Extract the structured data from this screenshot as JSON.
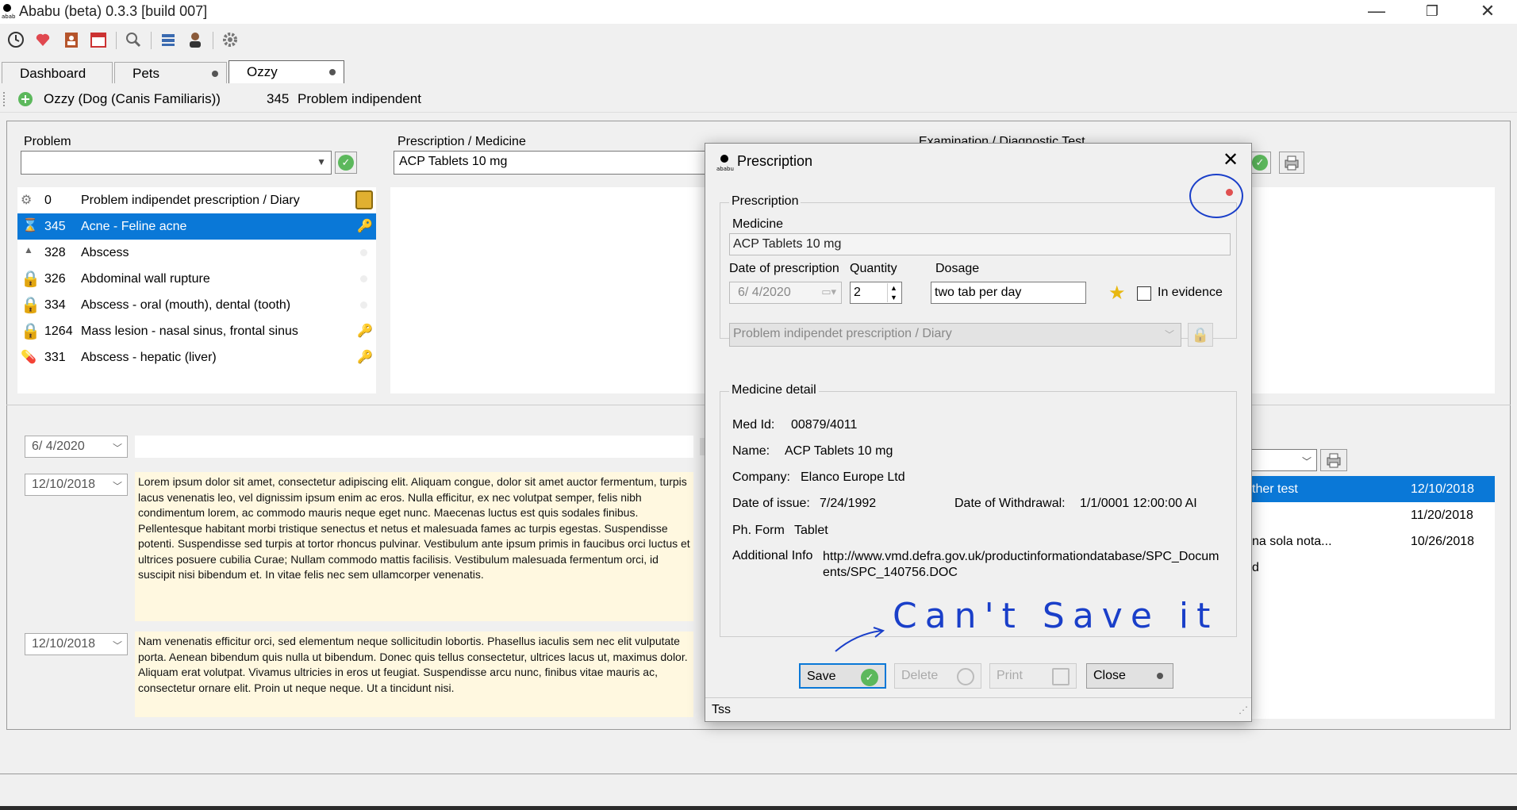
{
  "window": {
    "title": "Ababu (beta) 0.3.3 [build 007]",
    "minimize": "—",
    "restore": "❐",
    "close": "✕"
  },
  "toolbar": {
    "icons": [
      "clock-icon",
      "heart-icon",
      "contacts-icon",
      "calendar-icon",
      "search-icon",
      "list-icon",
      "person-icon",
      "gear-icon"
    ]
  },
  "tabs": [
    {
      "label": "Dashboard"
    },
    {
      "label": "Pets"
    },
    {
      "label": "Ozzy"
    }
  ],
  "crumb": {
    "pet": "Ozzy (Dog (Canis Familiaris))",
    "problem_id": "345",
    "problem_text": "Problem indipendent"
  },
  "problem_panel": {
    "label": "Problem",
    "combo_value": "",
    "rows": [
      {
        "id": "0",
        "name": "Problem indipendet prescription / Diary"
      },
      {
        "id": "345",
        "name": "Acne - Feline acne"
      },
      {
        "id": "328",
        "name": "Abscess"
      },
      {
        "id": "326",
        "name": "Abdominal wall rupture"
      },
      {
        "id": "334",
        "name": "Abscess - oral (mouth), dental (tooth)"
      },
      {
        "id": "1264",
        "name": "Mass lesion - nasal sinus, frontal sinus"
      },
      {
        "id": "331",
        "name": "Abscess - hepatic (liver)"
      }
    ]
  },
  "prescription_panel": {
    "label": "Prescription / Medicine",
    "value": "ACP Tablets 10 mg"
  },
  "exam_panel": {
    "label": "Examination / Diagnostic Test"
  },
  "diary": {
    "top_date": "6/ 4/2020",
    "entries": [
      {
        "date": "12/10/2018",
        "text": "Lorem ipsum dolor sit amet, consectetur adipiscing elit. Aliquam congue, dolor sit amet auctor fermentum, turpis lacus venenatis leo, vel dignissim ipsum enim ac eros. Nulla efficitur, ex nec volutpat semper, felis nibh condimentum lorem, ac commodo mauris neque eget nunc. Maecenas luctus est quis sodales finibus. Pellentesque habitant morbi tristique senectus et netus et malesuada fames ac turpis egestas. Suspendisse potenti. Suspendisse sed turpis at tortor rhoncus pulvinar. Vestibulum ante ipsum primis in faucibus orci luctus et ultrices posuere cubilia Curae; Nullam commodo mattis facilisis. Vestibulum malesuada fermentum orci, id suscipit nisi bibendum et. In vitae felis nec sem ullamcorper venenatis."
      },
      {
        "date": "12/10/2018",
        "text": "Nam venenatis efficitur orci, sed elementum neque sollicitudin lobortis. Phasellus iaculis sem nec elit vulputate porta. Aenean bibendum quis nulla ut bibendum. Donec quis tellus consectetur, ultrices lacus ut, maximus dolor. Aliquam erat volutpat. Vivamus ultricies in eros ut feugiat. Suspendisse arcu nunc, finibus vitae mauris ac, consectetur ornare elit. Proin ut neque neque. Ut a tincidunt nisi."
      }
    ]
  },
  "tests_list": [
    {
      "name": "ther test",
      "date": "12/10/2018"
    },
    {
      "name": "",
      "date": "11/20/2018"
    },
    {
      "name": "na sola nota...",
      "date": "10/26/2018"
    },
    {
      "name": "d",
      "date": ""
    }
  ],
  "dialog": {
    "title": "Prescription",
    "group_prescription": "Prescription",
    "medicine_label": "Medicine",
    "medicine_value": "ACP Tablets 10 mg",
    "date_label": "Date of prescription",
    "date_value": "6/ 4/2020",
    "quantity_label": "Quantity",
    "quantity_value": "2",
    "dosage_label": "Dosage",
    "dosage_value": "two tab per day",
    "evidence_label": "In evidence",
    "problem_value": "Problem indipendet prescription / Diary",
    "group_detail": "Medicine detail",
    "med_id_label": "Med Id:",
    "med_id_value": "00879/4011",
    "name_label": "Name:",
    "name_value": "ACP Tablets 10 mg",
    "company_label": "Company:",
    "company_value": "Elanco Europe Ltd",
    "issue_label": "Date of issue:",
    "issue_value": "7/24/1992",
    "withdrawal_label": "Date of Withdrawal:",
    "withdrawal_value": "1/1/0001 12:00:00 AI",
    "form_label": "Ph. Form",
    "form_value": "Tablet",
    "info_label": "Additional Info",
    "info_value": "http://www.vmd.defra.gov.uk/productinformationdatabase/SPC_Documents/SPC_140756.DOC",
    "buttons": {
      "save": "Save",
      "delete": "Delete",
      "print": "Print",
      "close": "Close"
    },
    "status": "Tss",
    "handwriting": "Can't Save it"
  },
  "colors": {
    "selection": "#0a78d7",
    "notes_bg": "#fff8e0",
    "annotation": "#1a3fc9",
    "ok_green": "#5cb85c"
  }
}
